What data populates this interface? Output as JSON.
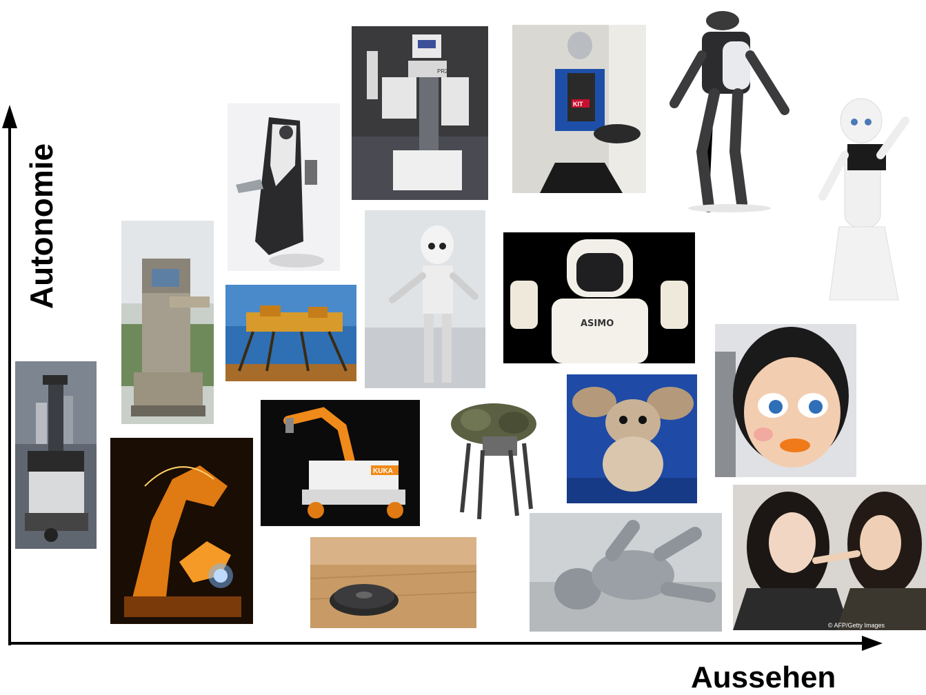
{
  "axes": {
    "y_label": "Autonomie",
    "x_label": "Aussehen"
  },
  "photos": [
    {
      "name": "photo-mobile-manipulator-tower",
      "description": "Mobile robot platform with stacked modules"
    },
    {
      "name": "photo-industrial-welding-robot",
      "description": "Orange industrial welding robot arms with sparks"
    },
    {
      "name": "photo-service-robot-kiosk",
      "description": "Service robot with display head and arm"
    },
    {
      "name": "photo-care-robot-tablet",
      "description": "White and black care robot with tray"
    },
    {
      "name": "photo-walking-machine",
      "description": "Multi-legged walking machine outdoors"
    },
    {
      "name": "photo-kuka-mobile-arm",
      "description": "KUKA mobile platform with robot arm",
      "text": "KUKA"
    },
    {
      "name": "photo-robot-vacuum",
      "description": "Round robot vacuum cleaner on wooden floor"
    },
    {
      "name": "photo-pr2-robot",
      "description": "PR2 two-armed research robot",
      "text": "PR2"
    },
    {
      "name": "photo-icub-robot",
      "description": "Child-sized humanoid robot standing"
    },
    {
      "name": "photo-bigdog-robot",
      "description": "Quadruped pack robot with camouflage"
    },
    {
      "name": "photo-armar-kitchen-robot",
      "description": "Humanoid kitchen robot holding a bowl",
      "text": "KIT"
    },
    {
      "name": "photo-asimo-robot",
      "description": "ASIMO humanoid robot raising both hands",
      "text": "ASIMO"
    },
    {
      "name": "photo-furry-creature-robot",
      "description": "Furry animatronic creature with large ears"
    },
    {
      "name": "photo-atlas-robot",
      "description": "Atlas bipedal humanoid robot"
    },
    {
      "name": "photo-pepper-robot",
      "description": "Pepper humanoid robot waving with chest tablet"
    },
    {
      "name": "photo-cartoon-face-robot",
      "description": "Robot with cartoon face, blue eyes and orange lips"
    },
    {
      "name": "photo-baby-android",
      "description": "Grey baby-shaped android lying on a table"
    },
    {
      "name": "photo-female-android",
      "description": "Female android next to a woman touching its face",
      "credit": "© AFP/Getty Images"
    }
  ],
  "colors": {
    "axis": "#000000",
    "background": "#ffffff"
  }
}
